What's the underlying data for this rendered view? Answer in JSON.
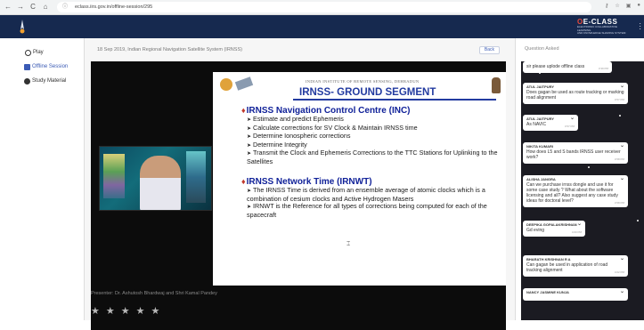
{
  "browser": {
    "url": "eclass.iirs.gov.in/offline-session/295",
    "nav": [
      "←",
      "→",
      "C",
      "⌂"
    ]
  },
  "header": {
    "brand_top": "E-CLASS",
    "brand_mark": "O",
    "brand_sub_1": "ELECTRONIC COLLABORATIVE LEARNING",
    "brand_sub_2": "AND KNOWLEDGE SHARING SYSTEM"
  },
  "sidebar": {
    "items": [
      {
        "label": "Play"
      },
      {
        "label": "Offline Session"
      },
      {
        "label": "Study Material"
      }
    ]
  },
  "main": {
    "title": "18 Sep 2019, Indian Regional Navigation Satellite System (IRNSS)",
    "back_label": "Back",
    "presenter": "Presenter: Dr. Ashutosh Bhardwaj and Shri Kamal Pandey",
    "rating": [
      "★",
      "★",
      "★",
      "★",
      "★"
    ]
  },
  "slide": {
    "institute": "INDIAN INSTITUTE OF REMOTE SENSING, DEHRADUN",
    "title": "IRNSS- GROUND SEGMENT",
    "sections": [
      {
        "heading": "IRNSS Navigation Control Centre (INC)",
        "points": [
          "Estimate and predict Ephemeris",
          "Calculate corrections for SV Clock & Maintain IRNSS time",
          "Determine Ionospheric corrections",
          "Determine Integrity",
          "Transmit the Clock and Ephemeris Corrections to the TTC Stations for Uplinking to the Satellites"
        ]
      },
      {
        "heading": "IRNSS Network Time (IRNWT)",
        "points": [
          "The IRNSS Time is derived from an ensemble average of atomic clocks which is a combination of cesium clocks and Active Hydrogen Masers",
          "IRNWT is the Reference for all types of corrections being computed for each of the spacecraft"
        ]
      }
    ]
  },
  "questions": {
    "title": "Question Asked",
    "items": [
      {
        "name": "",
        "msg": "sir please uplode offline class",
        "time": "3:39 PM"
      },
      {
        "name": "ATUL JAITPURY",
        "msg": "Does gagan be used as route tracking or marking road alignment",
        "time": "3:57 PM"
      },
      {
        "name": "ATUL JAITPURY",
        "msg": "As NAVIC",
        "time": "3:57 PM"
      },
      {
        "name": "Nikita Kumari",
        "msg": "How does L5 and S bands IRNSS user receiver work?",
        "time": "3:58 PM"
      },
      {
        "name": "Alisha Jangra",
        "msg": "Can we purchase irnss dongle and use it for some case study ? What about the software licensing and all? Also suggest any case study ideas for doctoral level?",
        "time": "3:58 PM"
      },
      {
        "name": "DEEPIKA GOPALAKRISHNAN",
        "msg": "Gd eving",
        "time": "4:00 PM"
      },
      {
        "name": "BHARATH KRISHNAN R A",
        "msg": "Can gagan be used in application of road tracking alignment",
        "time": "4:02 PM"
      },
      {
        "name": "NANCY JASMINE KUNJA",
        "msg": "",
        "time": ""
      }
    ]
  }
}
